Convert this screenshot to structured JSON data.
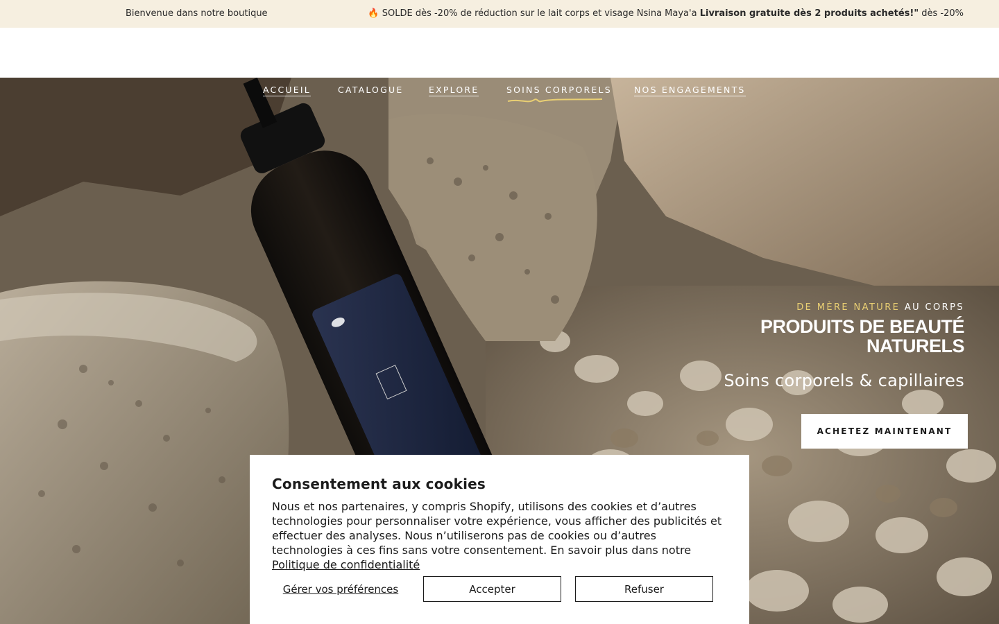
{
  "announcement": {
    "welcome": "Bienvenue dans notre boutique",
    "promo_icon": "🔥",
    "promo_text": "SOLDE dès -20% de réduction sur le lait corps et visage Nsina Maya'a",
    "promo_bold": "Livraison gratuite dès 2 produits achetés!\"",
    "promo_tail": "dès -20%"
  },
  "nav": {
    "items": [
      {
        "label": "ACCUEIL"
      },
      {
        "label": "CATALOGUE"
      },
      {
        "label": "EXPLORE"
      },
      {
        "label": "SOINS CORPORELS"
      },
      {
        "label": "NOS ENGAGEMENTS"
      }
    ],
    "active_index": 3
  },
  "hero": {
    "eyebrow_accent": "DE MÈRE NATURE",
    "eyebrow_rest": "AU CORPS",
    "title_line1": "PRODUITS DE BEAUTÉ",
    "title_line2": "NATURELS",
    "subtitle": "Soins corporels & capillaires",
    "cta_label": "ACHETEZ MAINTENANT",
    "background": "photo-amber-bottle-on-rocks"
  },
  "cookie_banner": {
    "title": "Consentement aux cookies",
    "body": "Nous et nos partenaires, y compris Shopify, utilisons des cookies et d’autres technologies pour personnaliser votre expérience, vous afficher des publicités et effectuer des analyses. Nous n’utiliserons pas de cookies ou d’autres technologies à ces fins sans votre consentement. En savoir plus dans notre",
    "policy_link": "Politique de confidentialité",
    "manage_label": "Gérer vos préférences",
    "accept_label": "Accepter",
    "refuse_label": "Refuser"
  },
  "colors": {
    "announcement_bg": "#f6efe0",
    "accent_gold": "#e9cf73",
    "text_dark": "#1b1b1b"
  }
}
